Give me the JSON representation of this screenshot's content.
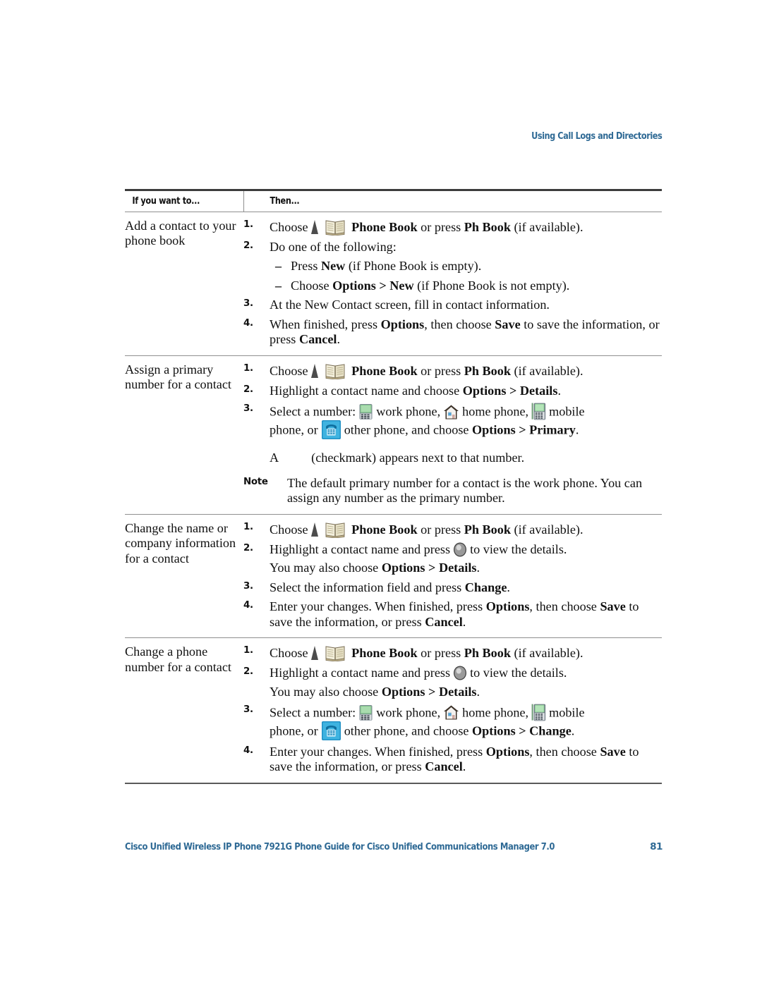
{
  "header": {
    "running_head": "Using Call Logs and Directories",
    "accent_color": "#2f6a95"
  },
  "table": {
    "columns": [
      {
        "label": "If you want to..."
      },
      {
        "label": "Then..."
      }
    ],
    "rows": [
      {
        "task": "Add a contact to your phone book",
        "steps": [
          {
            "text_before_icons": "Choose",
            "icons": [
              "navigation-triangle-icon",
              "phone-book-icon"
            ],
            "text_after_icons": "> Phone Book or press Ph Book (if available)."
          },
          {
            "text": "Do one of the following:",
            "dashes": [
              "Press New (if Phone Book is empty).",
              "Choose Options > New (if Phone Book is not empty)."
            ]
          },
          {
            "text": "At the New Contact screen, fill in contact information."
          },
          {
            "text": "When finished, press Options, then choose Save to save the information, or press Cancel."
          }
        ]
      },
      {
        "task": "Assign a primary number for a contact",
        "steps": [
          {
            "text_before_icons": "Choose",
            "icons": [
              "navigation-triangle-icon",
              "phone-book-icon"
            ],
            "text_after_icons": "> Phone Book or press Ph Book (if available)."
          },
          {
            "text": "Highlight a contact name and choose Options > Details."
          },
          {
            "text": "Select a number: [work-phone-icon] work phone, [home-phone-icon] home phone, [mobile-phone-icon] mobile phone, or [other-phone-icon] other phone, and choose Options > Primary."
          }
        ],
        "checkmark_note": {
          "prefix": "A",
          "text": "(checkmark) appears next to that number."
        },
        "note": {
          "label": "Note",
          "text": "The default primary number for a contact is the work phone. You can assign any number as the primary number."
        }
      },
      {
        "task": "Change the name or company information for a contact",
        "steps": [
          {
            "text_before_icons": "Choose",
            "icons": [
              "navigation-triangle-icon",
              "phone-book-icon"
            ],
            "text_after_icons": "> Phone Book or press Ph Book (if available)."
          },
          {
            "text": "Highlight a contact name and press [select-button-icon] to view the details.",
            "sub": "You may also choose Options > Details."
          },
          {
            "text": "Select the information field and press Change."
          },
          {
            "text": "Enter your changes. When finished, press Options, then choose Save to save the information, or press Cancel."
          }
        ]
      },
      {
        "task": "Change a phone number for a contact",
        "steps": [
          {
            "text_before_icons": "Choose",
            "icons": [
              "navigation-triangle-icon",
              "phone-book-icon"
            ],
            "text_after_icons": "> Phone Book or press Ph Book (if available)."
          },
          {
            "text": "Highlight a contact name and press [select-button-icon] to view the details.",
            "sub": "You may also choose Options > Details."
          },
          {
            "text": "Select a number: [work-phone-icon] work phone, [home-phone-icon] home phone, [mobile-phone-icon] mobile phone, or [other-phone-icon] other phone, and choose Options > Change."
          },
          {
            "text": "Enter your changes. When finished, press Options, then choose Save to save the information, or press Cancel."
          }
        ]
      }
    ]
  },
  "text": {
    "choose": "Choose",
    "phone_book_tail_1": ">",
    "phone_book_bold": "Phone Book",
    "or_press": "or press",
    "ph_book_bold": "Ph Book",
    "if_available": "(if available).",
    "do_one_of_following": "Do one of the following:",
    "press": "Press",
    "new_bold": "New",
    "if_pb_empty": "(if Phone Book is empty).",
    "options_bold": "Options",
    "gt": ">",
    "if_pb_not_empty": "(if Phone Book is not empty).",
    "step3_r1": "At the New Contact screen, fill in contact information.",
    "when_finished_press": "When finished, press",
    "comma_then_choose": ", then choose",
    "save_bold": "Save",
    "to_save_the_info": "to save the information,",
    "or_press_2": "or press",
    "cancel_bold": "Cancel",
    "period": ".",
    "highlight_choose": "Highlight a contact name and choose",
    "details_bold": "Details",
    "select_a_number": "Select a number:",
    "work_phone": "work phone,",
    "home_phone": "home phone,",
    "mobile": "mobile",
    "phone_or": "phone, or",
    "other_phone_and_choose": "other phone, and choose",
    "primary_bold": "Primary",
    "change_bold": "Change",
    "check_a": "A",
    "check_rest": "(checkmark) appears next to that number.",
    "note_label": "Note",
    "note_text": "The default primary number for a contact is the work phone. You can assign any number as the primary number.",
    "highlight_press": "Highlight a contact name and press",
    "to_view_details": "to view the details.",
    "you_may_also_choose": "You may also choose",
    "select_info_field": "Select the information field and press",
    "enter_your_changes": "Enter your changes. When finished, press",
    "save_info_or_press": "save the information, or press"
  },
  "footer": {
    "title": "Cisco Unified Wireless IP Phone 7921G Phone Guide for Cisco Unified Communications Manager 7.0",
    "page": "81"
  },
  "icons": {
    "navigation_triangle": "navigation-triangle-icon",
    "phone_book": "phone-book-icon",
    "work_phone": "work-phone-icon",
    "home_phone": "home-phone-icon",
    "mobile_phone": "mobile-phone-icon",
    "other_phone": "other-phone-icon",
    "select_button": "select-button-icon"
  }
}
